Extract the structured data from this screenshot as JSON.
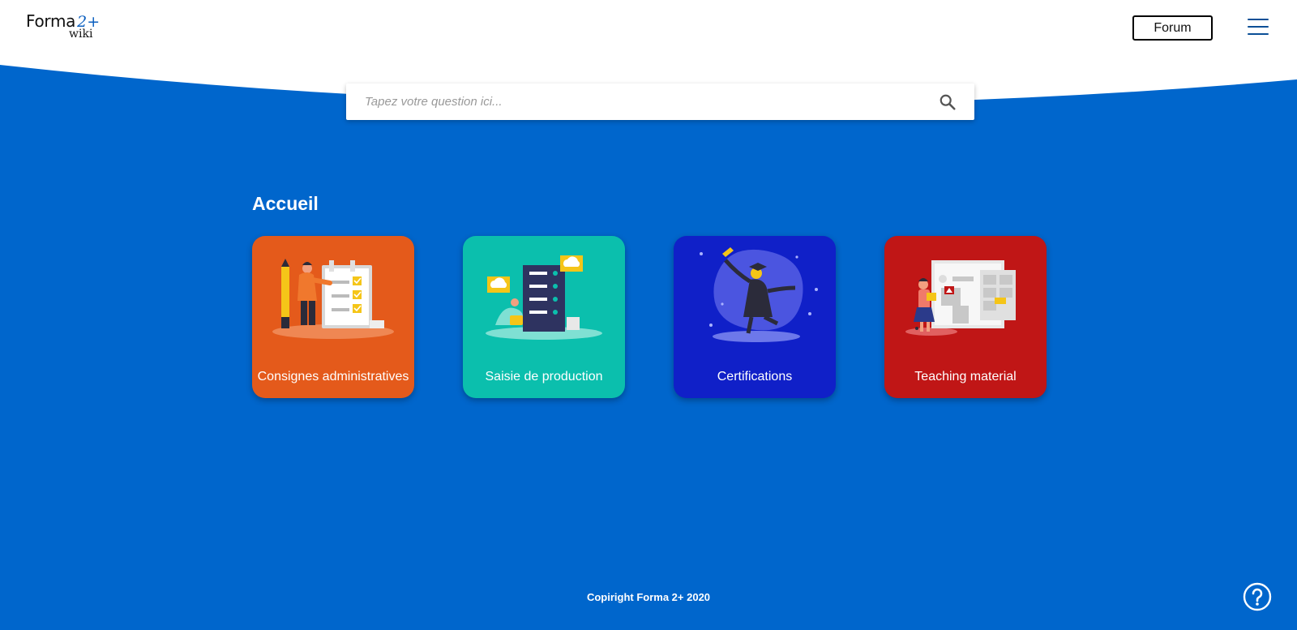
{
  "header": {
    "logo_text": "Forma",
    "logo_sup": "2+",
    "logo_sub": "wiki",
    "forum_label": "Forum",
    "menu_icon": "hamburger-menu-icon"
  },
  "search": {
    "placeholder": "Tapez votre question ici...",
    "value": "",
    "icon": "search-icon"
  },
  "main": {
    "title": "Accueil",
    "cards": [
      {
        "label": "Consignes administratives",
        "color": "#e45a1b"
      },
      {
        "label": "Saisie de production",
        "color": "#0bbfad"
      },
      {
        "label": "Certifications",
        "color": "#1020c8"
      },
      {
        "label": "Teaching material",
        "color": "#c01616"
      }
    ]
  },
  "footer": {
    "copyright": "Copiright Forma 2+ 2020"
  },
  "help": {
    "icon": "help-question-icon"
  },
  "colors": {
    "background": "#0066cc",
    "header": "#ffffff"
  }
}
